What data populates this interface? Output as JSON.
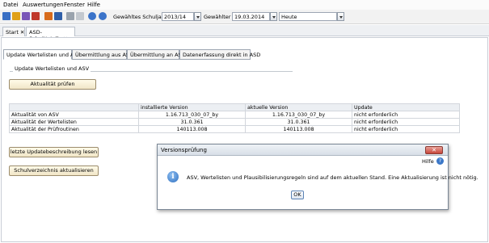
{
  "menu": [
    "Datei",
    "Auswertungen",
    "Fenster",
    "Hilfe"
  ],
  "toolbar": {
    "schuljahr_label": "Gewähltes Schuljahr",
    "schuljahr_value": "2013/14",
    "tag_label": "Gewählter Tag",
    "tag_value": "19.03.2014",
    "heute_value": "Heute"
  },
  "doc_tabs": [
    {
      "label": "Start"
    },
    {
      "label": "ASD-Schnittstelle"
    }
  ],
  "inner_tabs": [
    "Update Wertelisten und ASV",
    "Übermittlung aus ASD",
    "Übermittlung an ASD",
    "Datenerfassung direkt in ASD"
  ],
  "section": {
    "title": "Update Wertelisten und ASV",
    "check_button": "Aktualität prüfen",
    "changelog_button": "letzte Updatebeschreibung lesen",
    "school_button": "Schulverzeichnis aktualisieren"
  },
  "table": {
    "headers": [
      "",
      "installierte Version",
      "aktuelle Version",
      "Update"
    ],
    "rows": [
      [
        "Aktualität von ASV",
        "1.16.713_030_07_by",
        "1.16.713_030_07_by",
        "nicht erforderlich"
      ],
      [
        "Aktualität der Wertelisten",
        "31.0.361",
        "31.0.361",
        "nicht erforderlich"
      ],
      [
        "Aktualität der Prüfroutinen",
        "140113.008",
        "140113.008",
        "nicht erforderlich"
      ]
    ]
  },
  "dialog": {
    "title": "Versionsprüfung",
    "help_label": "Hilfe",
    "message": "ASV, Wertelisten und Plausibilisierungsregeln sind auf dem aktuellen Stand. Eine Aktualisierung ist nicht nötig.",
    "ok_label": "OK"
  }
}
